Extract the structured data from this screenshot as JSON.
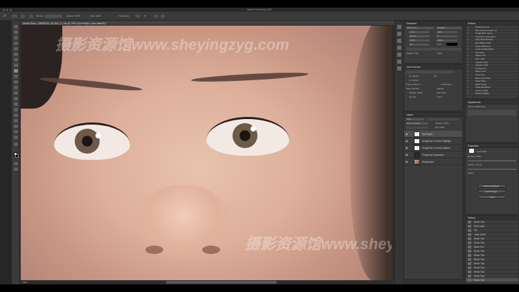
{
  "window": {
    "title": "Adobe Photoshop 2020"
  },
  "document": {
    "tab_label": "Adobe Stock_106835218_Sh (Kilo_Yi_Sa) @ 100% (Eye Bright, Layer Mask/8) *"
  },
  "watermark": {
    "text": "摄影资源馆www.sheyingzyg.com"
  },
  "options_bar": {
    "mode_label": "Normal",
    "opacity_label": "Opacity: 100%",
    "flow_label": "Flow: 100%",
    "smoothing_label": "Smoothing",
    "angle_label": "0°"
  },
  "properties_panel": {
    "title": "Character",
    "rows": [
      "Minion Pro",
      "Regular",
      "12 pt",
      "Auto",
      "Metrics",
      "0",
      "100%",
      "100%",
      "0 pt",
      "Color"
    ],
    "lang": "English: USA",
    "aa": "Sharp"
  },
  "paragraph_panel": {
    "title": "Clone Source",
    "rows": [
      "W: 100.0%",
      "H: 100.0%",
      "0.0°",
      "Frame Offset: 0",
      "Lock Frame",
      "Show Overlay",
      "Opacity: 100%",
      "Normal",
      "Auto Hide",
      "Clipped",
      "Invert"
    ]
  },
  "layers_panel": {
    "title": "Layers",
    "kind_label": "Kind",
    "blend_mode": "Pass Through",
    "opacity_label": "Opacity: 100%",
    "fill_label": "Fill: 100%",
    "layers": [
      {
        "name": "Eye Bright",
        "thumb": "white",
        "selected": true
      },
      {
        "name": "Dodge Burn Curves Highlight",
        "thumb": "white",
        "selected": false
      },
      {
        "name": "Dodge Burn Curves Shadow",
        "thumb": "white",
        "selected": false
      },
      {
        "name": "Frequency Separation",
        "thumb": "dark",
        "selected": false
      },
      {
        "name": "Background",
        "thumb": "photo",
        "selected": false
      }
    ]
  },
  "actions_panel": {
    "title": "Actions",
    "items": [
      "Default Actions",
      "Skin Retouch Action v2",
      "Dodge Burn Setup",
      "Frequency Separation",
      "High Pass Sharpen",
      "Eye Bright Action",
      "Teeth Whitening",
      "Color Grading Pack",
      "Soft Glow",
      "Matte Look",
      "Film Grain",
      "Vignette Dark",
      "Vignette Light",
      "Portrait Pop",
      "Warm Tone",
      "Cool Tone",
      "Black and White",
      "Sepia Tone",
      "HDR Toning",
      "Noise Reduction",
      "Save for Web",
      "Resize 2048px"
    ]
  },
  "adjustments_panel": {
    "title": "Adjustments",
    "label": "Add an adjustment"
  },
  "props2_panel": {
    "title": "Properties",
    "layer_label": "Layer Mask",
    "density_label": "Density: 100%",
    "feather_label": "Feather: 0.0 px",
    "refine_label": "Refine",
    "select_mask_btn": "Select and Mask...",
    "color_range_btn": "Color Range...",
    "invert_btn": "Invert"
  },
  "history_panel": {
    "title": "History",
    "items": [
      "Brush Tool",
      "New Layer",
      "Fill",
      "Layer Order",
      "Brush Tool",
      "Brush Tool",
      "Mask Tool",
      "Brush Tool",
      "Brush Tool",
      "Brush Tool",
      "Brush Tool",
      "Brush Tool",
      "Brush Tool",
      "Brush Tool",
      "Brush Tool"
    ]
  },
  "status_bar": {
    "zoom": "100%"
  }
}
